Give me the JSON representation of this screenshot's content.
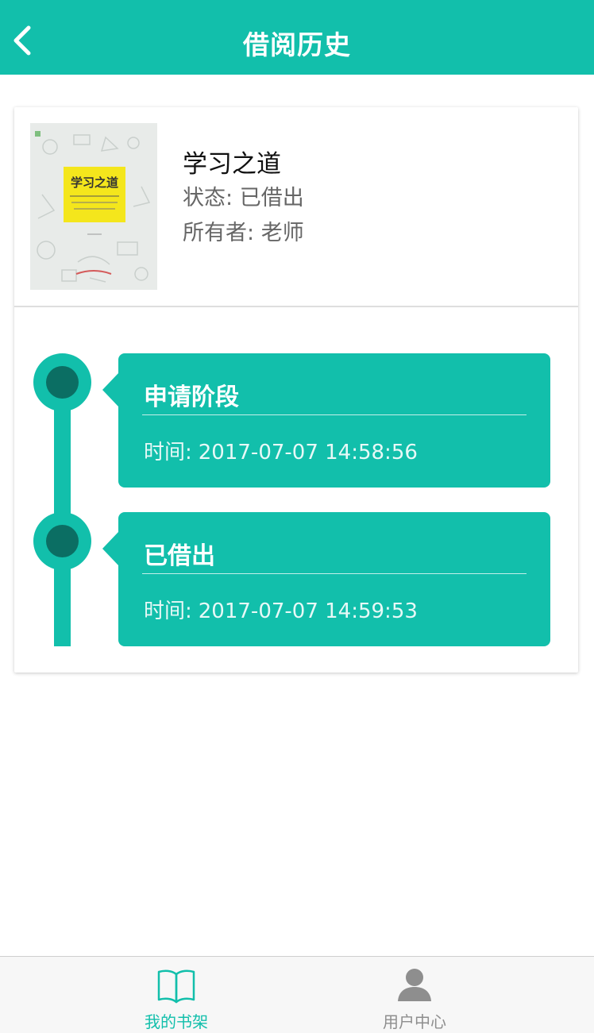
{
  "header": {
    "title": "借阅历史",
    "back_icon": "chevron-left-icon"
  },
  "book": {
    "title": "学习之道",
    "status_label": "状态:",
    "status_value": "已借出",
    "owner_label": "所有者:",
    "owner_value": "老师",
    "cover_title": "学习之道"
  },
  "timeline": [
    {
      "title": "申请阶段",
      "time_label": "时间:",
      "time_value": "2017-07-07 14:58:56"
    },
    {
      "title": "已借出",
      "time_label": "时间:",
      "time_value": "2017-07-07 14:59:53"
    }
  ],
  "tabbar": {
    "items": [
      {
        "label": "我的书架",
        "icon": "book-icon",
        "active": true
      },
      {
        "label": "用户中心",
        "icon": "user-icon",
        "active": false
      }
    ]
  },
  "colors": {
    "accent": "#12bfab",
    "node_center": "#0b6e63",
    "inactive": "#8e8e8e"
  }
}
